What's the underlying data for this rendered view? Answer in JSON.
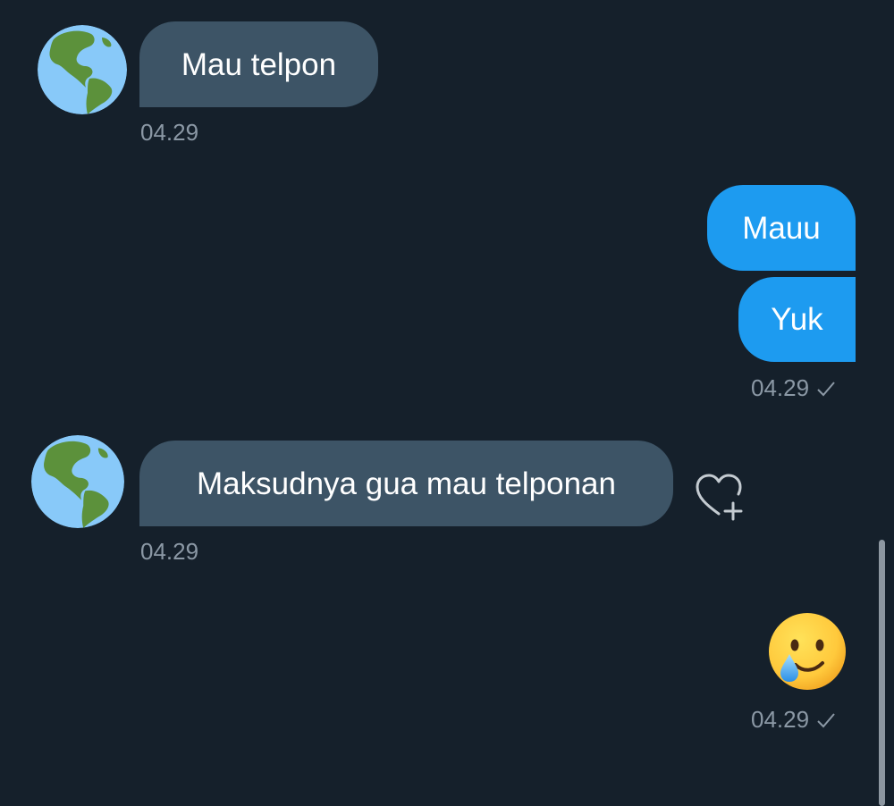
{
  "messages": [
    {
      "direction": "incoming",
      "text": "Mau telpon",
      "time": "04.29"
    },
    {
      "direction": "outgoing",
      "text": "Mauu"
    },
    {
      "direction": "outgoing",
      "text": "Yuk",
      "time": "04.29"
    },
    {
      "direction": "incoming",
      "text": "Maksudnya gua mau telponan",
      "time": "04.29"
    },
    {
      "direction": "outgoing",
      "emoji": "smiling-face-with-tear",
      "time": "04.29"
    }
  ],
  "icons": {
    "avatar": "globe-americas-icon",
    "sent_status": "checkmark-icon",
    "add_reaction": "heart-plus-icon"
  },
  "colors": {
    "background": "#15202b",
    "incoming_bubble": "#3d5466",
    "outgoing_bubble": "#1d9bf0",
    "timestamp": "#8b98a5"
  }
}
